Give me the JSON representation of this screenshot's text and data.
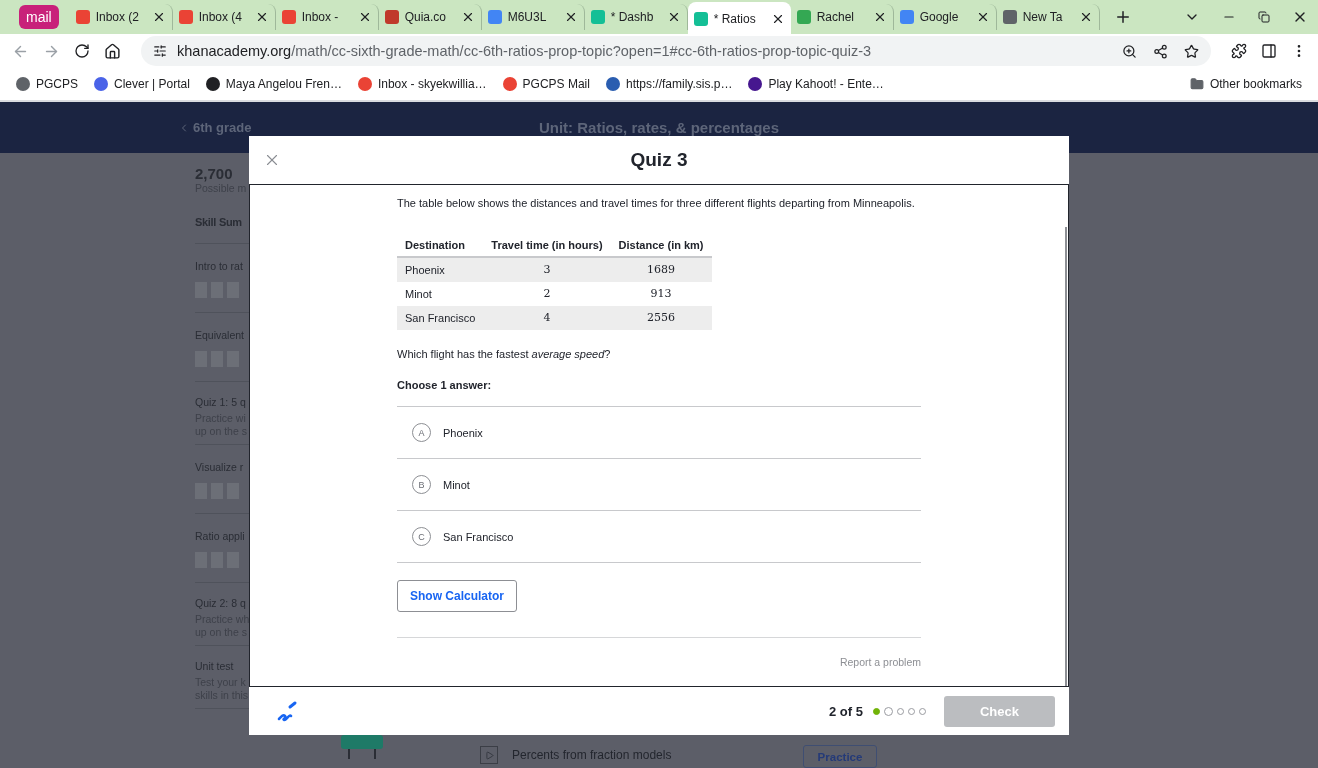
{
  "browser": {
    "tabs": [
      {
        "kind": "group",
        "title": "mail",
        "color": "#c8217a"
      },
      {
        "kind": "tab",
        "title": "Inbox (2",
        "color": "#ea4335",
        "selected": false
      },
      {
        "kind": "tab",
        "title": "Inbox (4",
        "color": "#ea4335",
        "selected": false
      },
      {
        "kind": "tab",
        "title": "Inbox -",
        "color": "#ea4335",
        "selected": false
      },
      {
        "kind": "tab",
        "title": "Quia.co",
        "color": "#c0392b",
        "selected": false
      },
      {
        "kind": "tab",
        "title": "M6U3L",
        "color": "#4285f4",
        "selected": false
      },
      {
        "kind": "tab",
        "title": "* Dashb",
        "color": "#14bf96",
        "selected": false
      },
      {
        "kind": "tab",
        "title": "* Ratios",
        "color": "#14bf96",
        "selected": true
      },
      {
        "kind": "tab",
        "title": "Rachel",
        "color": "#34a853",
        "selected": false
      },
      {
        "kind": "tab",
        "title": "Google",
        "color": "#4285f4",
        "selected": false
      },
      {
        "kind": "tab",
        "title": "New Ta",
        "color": "#5f6368",
        "selected": false
      }
    ],
    "url_host": "khanacademy.org",
    "url_path": "/math/cc-sixth-grade-math/cc-6th-ratios-prop-topic?open=1#cc-6th-ratios-prop-topic-quiz-3",
    "bookmarks": [
      {
        "title": "PGCPS",
        "color": "#5f6368"
      },
      {
        "title": "Clever | Portal",
        "color": "#4a63e8"
      },
      {
        "title": "Maya Angelou Fren…",
        "color": "#202124"
      },
      {
        "title": "Inbox - skyekwillia…",
        "color": "#ea4335"
      },
      {
        "title": "PGCPS Mail",
        "color": "#ea4335"
      },
      {
        "title": "https://family.sis.p…",
        "color": "#2a5db0"
      },
      {
        "title": "Play Kahoot! - Ente…",
        "color": "#46178f"
      }
    ],
    "other_bookmarks": "Other bookmarks"
  },
  "page": {
    "back_link": "6th grade",
    "unit_title": "Unit: Ratios, rates, & percentages",
    "points": "2,700",
    "points_label": "Possible m",
    "summary_heading": "Skill Sum",
    "skills": [
      {
        "kind": "skill",
        "title": "Intro to rat"
      },
      {
        "kind": "skill",
        "title": "Equivalent"
      },
      {
        "kind": "quiz",
        "title": "Quiz 1: 5 q",
        "lines": [
          "Practice wi",
          "up on the s"
        ]
      },
      {
        "kind": "skill",
        "title": "Visualize r"
      },
      {
        "kind": "skill",
        "title": "Ratio appli"
      },
      {
        "kind": "quiz",
        "title": "Quiz 2: 8 q",
        "lines": [
          "Practice wh",
          "up on the s"
        ]
      },
      {
        "kind": "quiz",
        "title": "Unit test",
        "lines": [
          "Test your k",
          "skills in this"
        ]
      }
    ],
    "lesson": "Percents from fraction models",
    "practice_button": "Practice"
  },
  "modal": {
    "title": "Quiz 3",
    "intro": "The table below shows the distances and travel times for three different flights departing from Minneapolis.",
    "table": {
      "columns": [
        "Destination",
        "Travel time (in hours)",
        "Distance (in km)"
      ],
      "rows": [
        [
          "Phoenix",
          "3",
          "1689"
        ],
        [
          "Minot",
          "2",
          "913"
        ],
        [
          "San Francisco",
          "4",
          "2556"
        ]
      ]
    },
    "question": "Which flight has the fastest *average speed*?",
    "prompt": "Choose 1 answer:",
    "choices": [
      {
        "letter": "A",
        "label": "Phoenix",
        "selected": false
      },
      {
        "letter": "B",
        "label": "Minot",
        "selected": false
      },
      {
        "letter": "C",
        "label": "San Francisco",
        "selected": false
      }
    ],
    "calculator_button": "Show Calculator",
    "report_link": "Report a problem",
    "progress": "2 of 5",
    "steps": [
      {
        "done": true,
        "current": false
      },
      {
        "done": false,
        "current": true
      },
      {
        "done": false,
        "current": false
      },
      {
        "done": false,
        "current": false
      },
      {
        "done": false,
        "current": false
      }
    ],
    "check_button": {
      "label": "Check",
      "disabled": true
    }
  }
}
